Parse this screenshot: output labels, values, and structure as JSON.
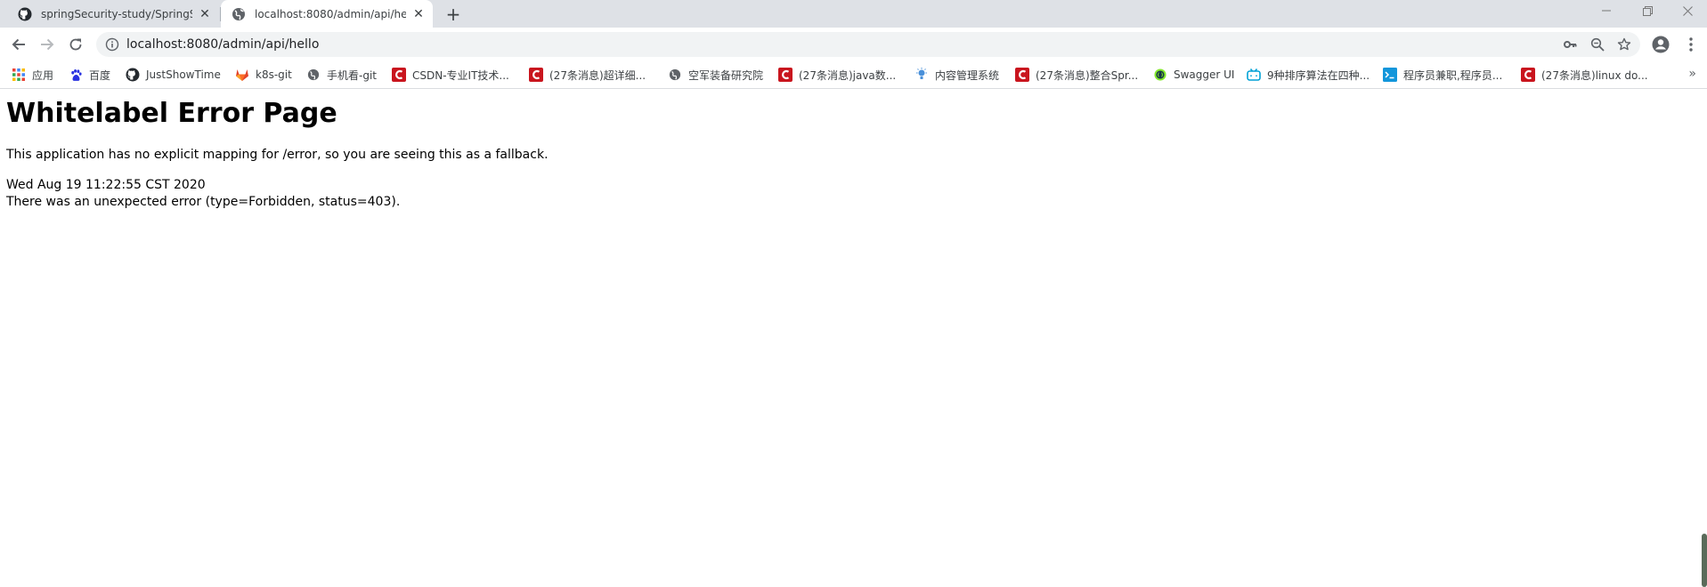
{
  "tabs": [
    {
      "title": "springSecurity-study/SpringSecurity",
      "icon": "github-icon"
    },
    {
      "title": "localhost:8080/admin/api/hello",
      "icon": "globe-icon"
    }
  ],
  "toolbar": {
    "url": "localhost:8080/admin/api/hello"
  },
  "bookmarks": [
    {
      "label": "应用",
      "icon": "apps-grid-icon",
      "color": "#4285f4"
    },
    {
      "label": "百度",
      "icon": "baidu-paw-icon",
      "color": "#2932e1"
    },
    {
      "label": "JustShowTime",
      "icon": "github-icon",
      "color": "#24292e"
    },
    {
      "label": "k8s-git",
      "icon": "gitlab-icon",
      "color": "#e24329"
    },
    {
      "label": "手机看-git",
      "icon": "globe-icon",
      "color": "#5f6368"
    },
    {
      "label": "CSDN-专业IT技术...",
      "icon": "csdn-icon",
      "color": "#c9151e"
    },
    {
      "label": "(27条消息)超详细...",
      "icon": "csdn-icon",
      "color": "#c9151e"
    },
    {
      "label": "空军装备研究院",
      "icon": "globe-icon",
      "color": "#5f6368"
    },
    {
      "label": "(27条消息)java数...",
      "icon": "csdn-icon",
      "color": "#c9151e"
    },
    {
      "label": "内容管理系统",
      "icon": "bulb-icon",
      "color": "#4a90d9"
    },
    {
      "label": "(27条消息)整合Spr...",
      "icon": "csdn-icon",
      "color": "#c9151e"
    },
    {
      "label": "Swagger UI",
      "icon": "swagger-icon",
      "color": "#85ea2d"
    },
    {
      "label": "9种排序算法在四种...",
      "icon": "bilibili-icon",
      "color": "#00a1d6"
    },
    {
      "label": "程序员兼职,程序员...",
      "icon": "terminal-icon",
      "color": "#1296db"
    },
    {
      "label": "(27条消息)linux do...",
      "icon": "csdn-icon",
      "color": "#c9151e"
    }
  ],
  "page": {
    "heading": "Whitelabel Error Page",
    "message": "This application has no explicit mapping for /error, so you are seeing this as a fallback.",
    "timestamp": "Wed Aug 19 11:22:55 CST 2020",
    "error": "There was an unexpected error (type=Forbidden, status=403)."
  }
}
